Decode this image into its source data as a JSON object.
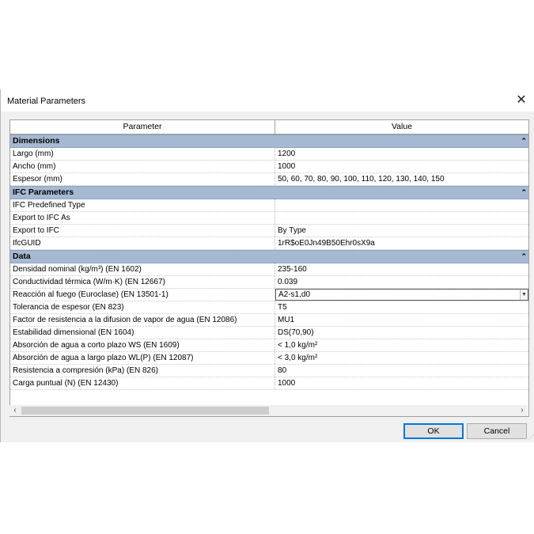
{
  "window": {
    "title": "Material Parameters"
  },
  "grid": {
    "headers": {
      "parameter": "Parameter",
      "value": "Value"
    },
    "groups": [
      {
        "name": "Dimensions",
        "rows": [
          {
            "param": "Largo (mm)",
            "value": "1200"
          },
          {
            "param": "Ancho (mm)",
            "value": "1000"
          },
          {
            "param": "Espesor (mm)",
            "value": "50, 60, 70, 80, 90, 100, 110, 120, 130, 140, 150"
          }
        ]
      },
      {
        "name": "IFC Parameters",
        "rows": [
          {
            "param": "IFC Predefined Type",
            "value": ""
          },
          {
            "param": "Export to IFC As",
            "value": ""
          },
          {
            "param": "Export to IFC",
            "value": "By Type"
          },
          {
            "param": "IfcGUID",
            "value": "1rR$oE0Jn49B50Ehr0sX9a"
          }
        ]
      },
      {
        "name": "Data",
        "rows": [
          {
            "param": "Densidad nominal (kg/m³) (EN 1602)",
            "value": "235-160"
          },
          {
            "param": "Conductividad térmica (W/m·K) (EN 12667)",
            "value": "0.039"
          },
          {
            "param": "Reacción al fuego (Euroclase) (EN 13501-1)",
            "value": "A2-s1,d0"
          },
          {
            "param": "Tolerancia de espesor (EN 823)",
            "value": "T5"
          },
          {
            "param": "Factor de resistencia a la difusion de vapor de agua (EN 12086)",
            "value": "MU1"
          },
          {
            "param": "Estabilidad dimensional (EN 1604)",
            "value": "DS(70,90)"
          },
          {
            "param": "Absorción de agua a corto plazo WS (EN 1609)",
            "value": "< 1,0 kg/m²"
          },
          {
            "param": "Absorción de agua a largo plazo WL(P) (EN 12087)",
            "value": "< 3,0 kg/m²"
          },
          {
            "param": "Resistencia a compresión (kPa) (EN 826)",
            "value": "80"
          },
          {
            "param": "Carga puntual (N) (EN 12430)",
            "value": "1000"
          }
        ]
      }
    ]
  },
  "buttons": {
    "ok": "OK",
    "cancel": "Cancel"
  },
  "icons": {
    "close": "close-icon",
    "collapse": "collapse-icon",
    "dropdown": "chevron-down-icon",
    "scroll_left": "chevron-left-icon",
    "scroll_right": "chevron-right-icon"
  },
  "colors": {
    "group_header": "#a6b9d2",
    "ok_border": "#0078d7"
  }
}
